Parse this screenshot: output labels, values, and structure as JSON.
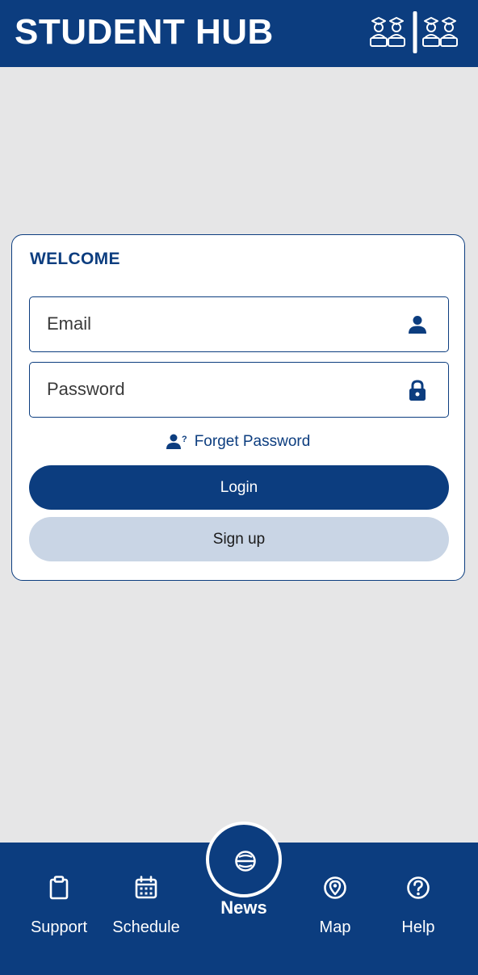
{
  "header": {
    "title": "STUDENT HUB",
    "logo_icon": "graduates-logo-icon",
    "background": "#0c3d7f"
  },
  "login": {
    "heading": "WELCOME",
    "email": {
      "placeholder": "Email",
      "value": "",
      "icon": "user-icon"
    },
    "password": {
      "placeholder": "Password",
      "value": "",
      "icon": "lock-icon"
    },
    "forget": {
      "label": "Forget Password",
      "icon": "user-question-icon"
    },
    "login_label": "Login",
    "signup_label": "Sign up"
  },
  "nav": {
    "items": [
      {
        "label": "Support",
        "icon": "clipboard-icon"
      },
      {
        "label": "Schedule",
        "icon": "calendar-icon"
      },
      {
        "label": "News",
        "icon": "globe-icon"
      },
      {
        "label": "Map",
        "icon": "map-pin-icon"
      },
      {
        "label": "Help",
        "icon": "help-circle-icon"
      }
    ]
  },
  "colors": {
    "primary": "#0c3d7f",
    "secondary_button": "#c9d5e5",
    "page_background": "#e6e6e7",
    "card_background": "#ffffff"
  }
}
